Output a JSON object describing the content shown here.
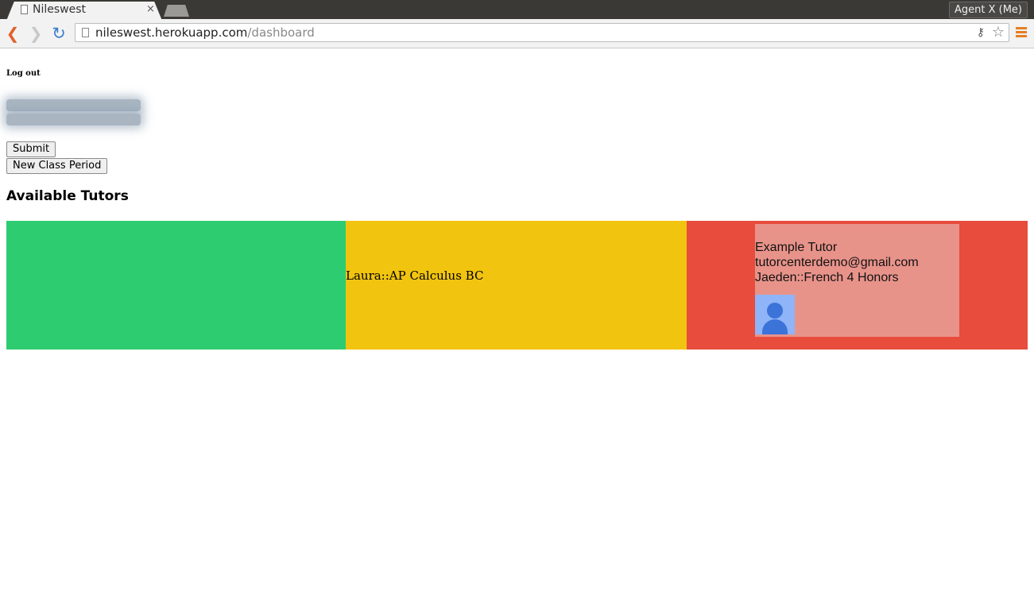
{
  "browser": {
    "tab_title": "Nileswest",
    "tab_close": "×",
    "profile_name": "Agent X (Me)",
    "url_host": "nileswest.herokuapp.com",
    "url_path": "/dashboard"
  },
  "page": {
    "logout_label": "Log out",
    "submit_label": "Submit",
    "new_class_period_label": "New Class Period",
    "heading": "Available Tutors"
  },
  "tutors": {
    "yellow_column_text": "Laura::AP Calculus BC",
    "card": {
      "name": "Example Tutor",
      "email": "tutorcenterdemo@gmail.com",
      "session": "Jaeden::French 4 Honors"
    }
  },
  "colors": {
    "green": "#2ecc71",
    "yellow": "#f1c40f",
    "red": "#e74c3c",
    "card": "#e8938a"
  }
}
